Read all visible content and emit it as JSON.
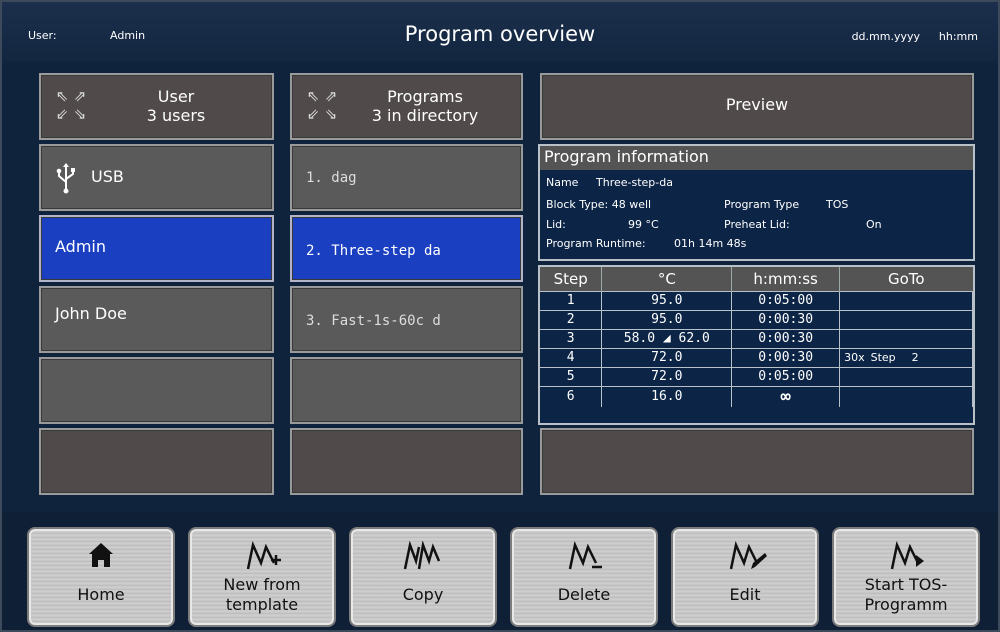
{
  "header": {
    "user_label": "User:",
    "user_value": "Admin",
    "title": "Program overview",
    "date": "dd.mm.yyyy",
    "time": "hh:mm"
  },
  "users_panel": {
    "header_title": "User",
    "header_count": "3  users",
    "items": [
      {
        "label": "USB",
        "icon": "usb-icon"
      },
      {
        "label": "Admin",
        "selected": true
      },
      {
        "label": "John Doe"
      },
      {
        "label": ""
      },
      {
        "label": ""
      }
    ]
  },
  "programs_panel": {
    "header_title": "Programs",
    "header_count": "3  in directory",
    "items": [
      {
        "label": "1. dag"
      },
      {
        "label": "2. Three-step da",
        "selected": true
      },
      {
        "label": "3. Fast-1s-60c d"
      },
      {
        "label": ""
      },
      {
        "label": ""
      }
    ]
  },
  "preview": {
    "label": "Preview"
  },
  "program_info": {
    "title": "Program information",
    "name_label": "Name",
    "name_value": "Three-step-da",
    "block_type": "Block Type: 48 well",
    "program_type_label": "Program Type",
    "program_type_value": "TOS",
    "lid_label": "Lid:",
    "lid_value": "99 °C",
    "preheat_label": "Preheat Lid:",
    "preheat_value": "On",
    "runtime_label": "Program Runtime:",
    "runtime_value": "01h 14m 48s"
  },
  "steps_table": {
    "headers": [
      "Step",
      "°C",
      "h:mm:ss",
      "GoTo"
    ],
    "rows": [
      {
        "step": "1",
        "temp": "95.0",
        "time": "0:05:00",
        "goto": ""
      },
      {
        "step": "2",
        "temp": "95.0",
        "time": "0:00:30",
        "goto": ""
      },
      {
        "step": "3",
        "temp": "58.0 ◢ 62.0",
        "time": "0:00:30",
        "goto": ""
      },
      {
        "step": "4",
        "temp": "72.0",
        "time": "0:00:30",
        "goto": "30x",
        "goto_step": "Step",
        "goto_num": "2"
      },
      {
        "step": "5",
        "temp": "72.0",
        "time": "0:05:00",
        "goto": ""
      },
      {
        "step": "6",
        "temp": "16.0",
        "time": "∞",
        "goto": ""
      }
    ]
  },
  "toolbar": {
    "home": {
      "label": "Home",
      "icon": "home-icon"
    },
    "new_from_template": {
      "line1": "New from",
      "line2": "template",
      "icon": "curve-plus-icon"
    },
    "copy": {
      "label": "Copy",
      "icon": "curve-copy-icon"
    },
    "delete": {
      "label": "Delete",
      "icon": "curve-minus-icon"
    },
    "edit": {
      "label": "Edit",
      "icon": "curve-pencil-icon"
    },
    "start": {
      "line1": "Start TOS-",
      "line2": "Programm",
      "icon": "curve-play-icon"
    }
  },
  "colors": {
    "background": "#10233d",
    "panel_gray": "#5a5a5a",
    "selected_blue": "#1a3fc0",
    "toolbar_button": "#c4c4c4"
  }
}
